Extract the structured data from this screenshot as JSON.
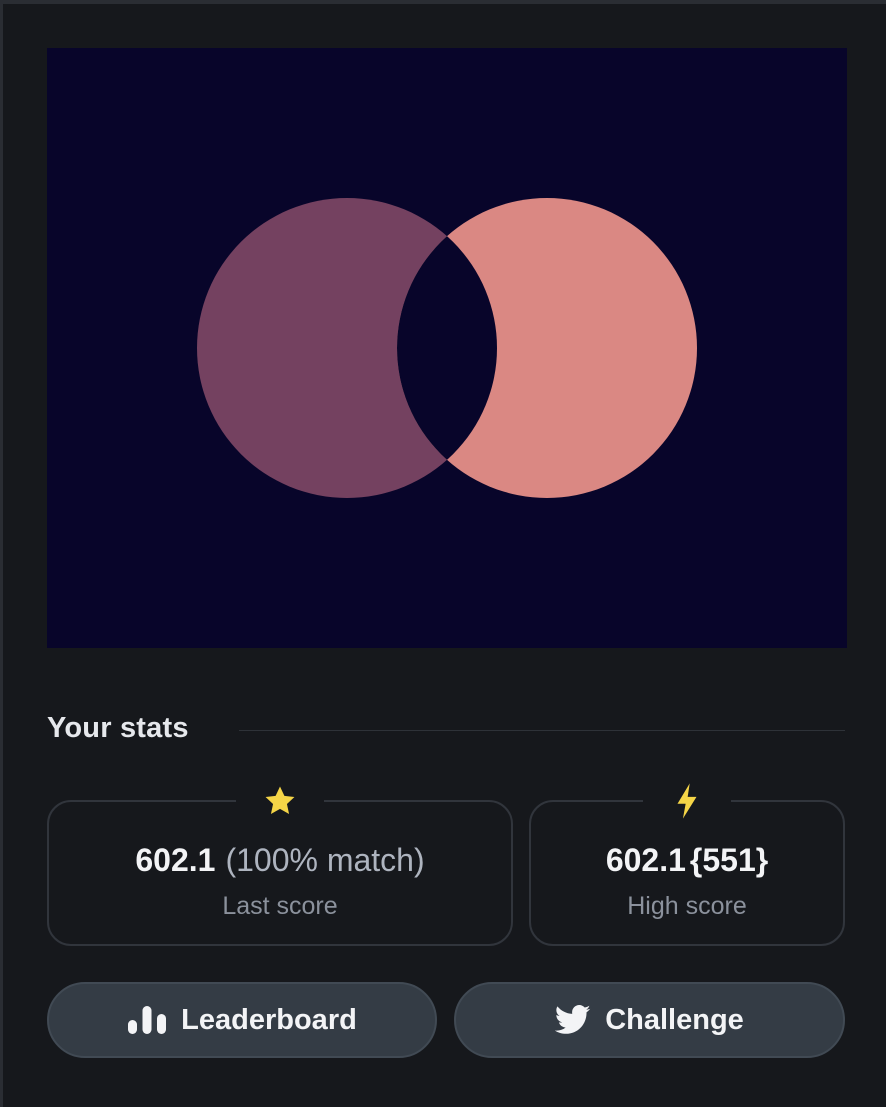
{
  "canvas": {
    "background": "#08052a",
    "left_circle_color": "#744160",
    "right_circle_color": "#da8883",
    "overlap_color": "#08052a"
  },
  "stats": {
    "heading": "Your stats",
    "last": {
      "icon": "star-icon",
      "icon_color": "#f5d547",
      "value": "602.1",
      "detail": "(100% match)",
      "label": "Last score"
    },
    "high": {
      "icon": "lightning-bolt-icon",
      "icon_color": "#f5d547",
      "value": "602.1",
      "detail": "{551}",
      "label": "High score"
    }
  },
  "actions": {
    "leaderboard": {
      "label": "Leaderboard",
      "icon": "bar-chart-icon"
    },
    "challenge": {
      "label": "Challenge",
      "icon": "twitter-bird-icon"
    }
  }
}
